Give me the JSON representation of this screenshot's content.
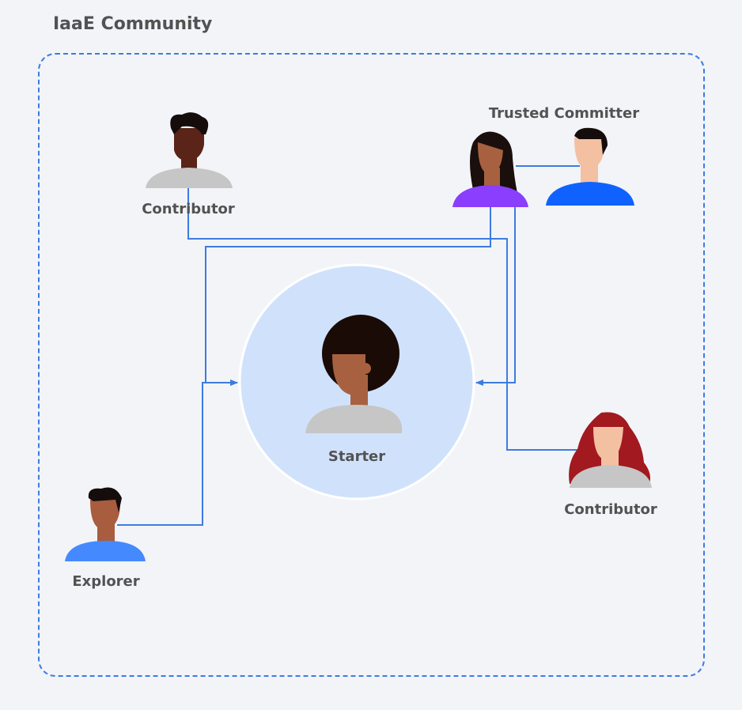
{
  "title": "IaaE Community",
  "colors": {
    "accent": "#3d7be0",
    "frame_border": "#3d7be0",
    "starter_circle": "#d0e2fb",
    "background": "#f2f4f8",
    "label": "#525252"
  },
  "nodes": {
    "starter": {
      "label": "Starter",
      "icon": "person-icon"
    },
    "contributor_top": {
      "label": "Contributor",
      "icon": "person-icon"
    },
    "trusted_committer": {
      "label": "Trusted Committer",
      "icon": "person-icon"
    },
    "contributor_right": {
      "label": "Contributor",
      "icon": "person-icon"
    },
    "explorer": {
      "label": "Explorer",
      "icon": "person-icon"
    }
  }
}
